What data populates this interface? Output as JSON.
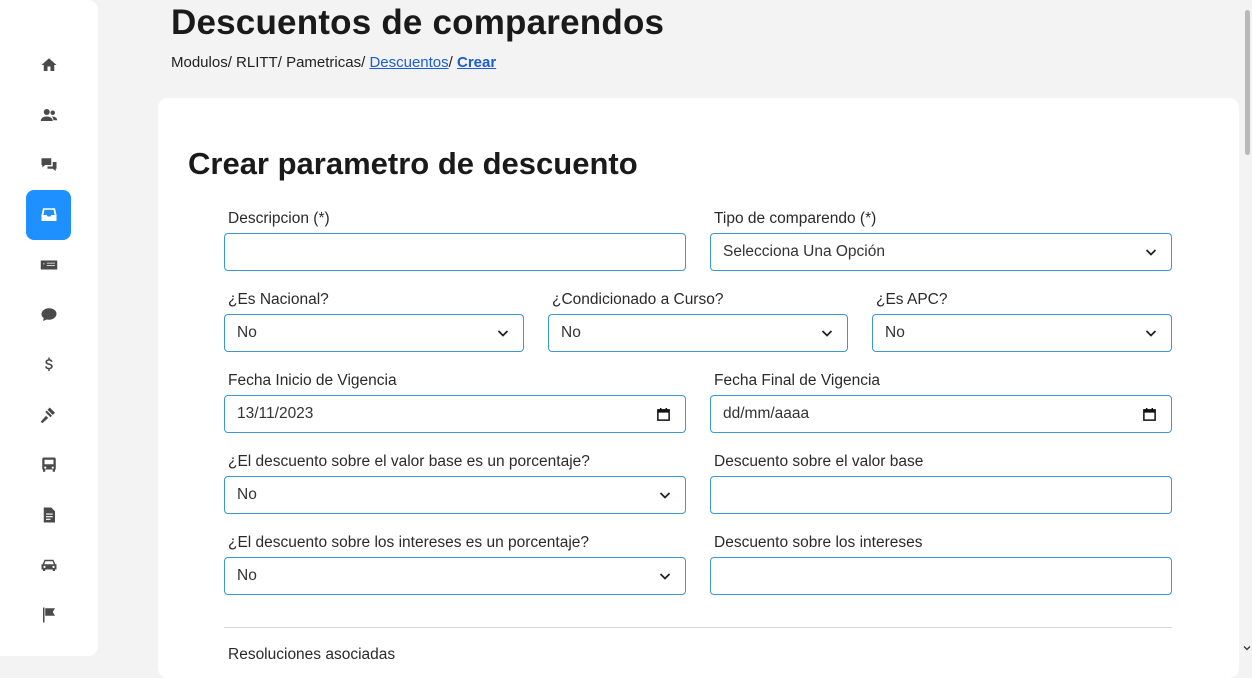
{
  "sidebar": {
    "items": [
      {
        "icon": "home-icon"
      },
      {
        "icon": "users-icon"
      },
      {
        "icon": "chat-question-icon"
      },
      {
        "icon": "inbox-icon",
        "active": true
      },
      {
        "icon": "money-bill-icon"
      },
      {
        "icon": "dollar-comment-icon"
      },
      {
        "icon": "dollar-icon"
      },
      {
        "icon": "gavel-icon"
      },
      {
        "icon": "bus-icon"
      },
      {
        "icon": "document-icon"
      },
      {
        "icon": "car-icon"
      },
      {
        "icon": "flag-icon"
      }
    ],
    "active_color": "#1e90ff"
  },
  "header": {
    "title": "Descuentos de comparendos",
    "breadcrumb": {
      "p1": "Modulos/",
      "p2": "RLITT/",
      "p3": "Pametricas/",
      "link": "Descuentos",
      "sep": "/",
      "current": "Crear"
    }
  },
  "form": {
    "title": "Crear parametro de descuento",
    "descripcion": {
      "label": "Descripcion (*)",
      "value": ""
    },
    "tipo": {
      "label": "Tipo de comparendo (*)",
      "value": "Selecciona Una Opción"
    },
    "nacional": {
      "label": "¿Es Nacional?",
      "value": "No"
    },
    "curso": {
      "label": "¿Condicionado a Curso?",
      "value": "No"
    },
    "apc": {
      "label": "¿Es APC?",
      "value": "No"
    },
    "fecha_inicio": {
      "label": "Fecha Inicio de Vigencia",
      "value": "13/11/2023"
    },
    "fecha_final": {
      "label": "Fecha Final de Vigencia",
      "value": "dd/mm/aaaa"
    },
    "base_pct": {
      "label": "¿El descuento sobre el valor base es un porcentaje?",
      "value": "No"
    },
    "base_val": {
      "label": "Descuento sobre el valor base",
      "value": ""
    },
    "int_pct": {
      "label": "¿El descuento sobre los intereses es un porcentaje?",
      "value": "No"
    },
    "int_val": {
      "label": "Descuento sobre los intereses",
      "value": ""
    },
    "next_section": "Resoluciones asociadas"
  },
  "colors": {
    "accent": "#1e90ff",
    "field_border": "#3a97d9",
    "link": "#1a5dd6"
  }
}
